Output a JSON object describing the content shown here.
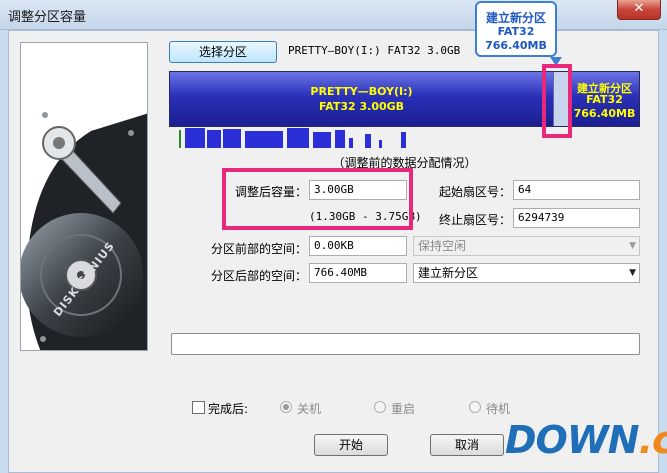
{
  "window": {
    "title": "调整分区容量",
    "close_glyph": "✕"
  },
  "disk_art": {
    "brand_text": "DISK GENIUS"
  },
  "toolbar": {
    "select_partition_label": "选择分区",
    "partition_info": "PRETTY—BOY(I:) FAT32 3.0GB"
  },
  "partition_bar": {
    "main": {
      "name": "PRETTY—BOY(I:)",
      "fs_size": "FAT32 3.00GB"
    },
    "new": {
      "title": "建立新分区",
      "fs": "FAT32",
      "size": "766.40MB"
    }
  },
  "callout": {
    "title": "建立新分区",
    "fs": "FAT32",
    "size": "766.40MB"
  },
  "usage_caption": "（调整前的数据分配情况）",
  "form": {
    "resized_capacity_label": "调整后容量：",
    "resized_capacity_value": "3.00GB",
    "capacity_range": "(1.30GB - 3.75GB)",
    "start_sector_label": "起始扇区号：",
    "start_sector_value": "64",
    "end_sector_label": "终止扇区号：",
    "end_sector_value": "6294739",
    "space_before_label": "分区前部的空间：",
    "space_before_value": "0.00KB",
    "space_before_action": "保持空闲",
    "space_after_label": "分区后部的空间：",
    "space_after_value": "766.40MB",
    "space_after_action": "建立新分区"
  },
  "completion": {
    "checkbox_label": "完成后:",
    "options": [
      "关机",
      "重启",
      "待机"
    ]
  },
  "buttons": {
    "start": "开始",
    "cancel": "取消"
  },
  "watermark": {
    "main": "DOWN",
    "suffix": ".cc"
  },
  "colors": {
    "partition_fill": "#2a2fb8",
    "partition_text": "#ffff00",
    "highlight": "#e8287a",
    "callout_border": "#3f7fd1"
  }
}
